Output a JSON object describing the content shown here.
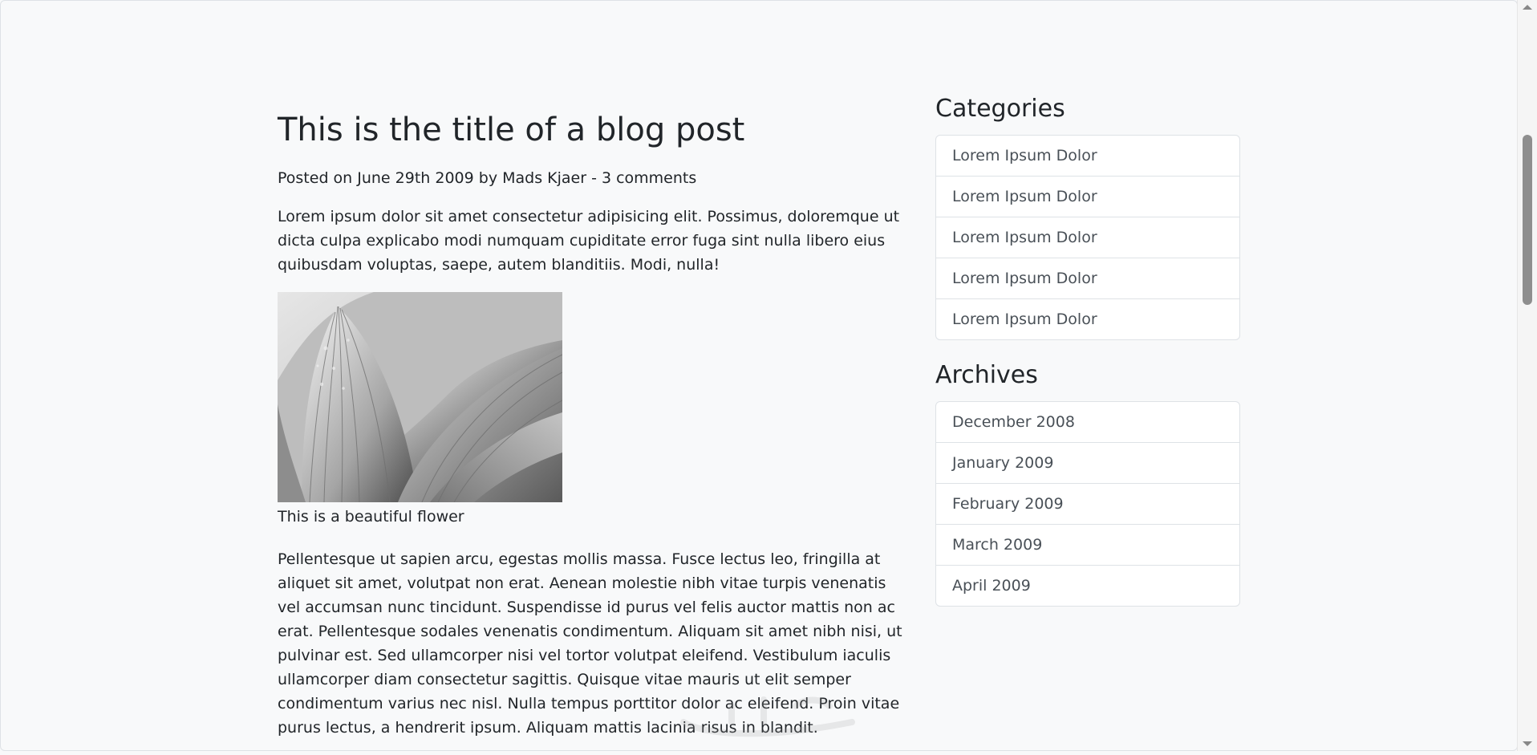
{
  "post": {
    "title": "This is the title of a blog post",
    "meta": "Posted on June 29th 2009 by Mads Kjaer - 3 comments",
    "intro": "Lorem ipsum dolor sit amet consectetur adipisicing elit. Possimus, doloremque ut dicta culpa explicabo modi numquam cupiditate error fuga sint nulla libero eius quibusdam voluptas, saepe, autem blanditiis. Modi, nulla!",
    "caption": "This is a beautiful flower",
    "body": "Pellentesque ut sapien arcu, egestas mollis massa. Fusce lectus leo, fringilla at aliquet sit amet, volutpat non erat. Aenean molestie nibh vitae turpis venenatis vel accumsan nunc tincidunt. Suspendisse id purus vel felis auctor mattis non ac erat. Pellentesque sodales venenatis condimentum. Aliquam sit amet nibh nisi, ut pulvinar est. Sed ullamcorper nisi vel tortor volutpat eleifend. Vestibulum iaculis ullamcorper diam consectetur sagittis. Quisque vitae mauris ut elit semper condimentum varius nec nisl. Nulla tempus porttitor dolor ac eleifend. Proin vitae purus lectus, a hendrerit ipsum. Aliquam mattis lacinia risus in blandit."
  },
  "sidebar": {
    "categories_heading": "Categories",
    "categories": [
      "Lorem Ipsum Dolor",
      "Lorem Ipsum Dolor",
      "Lorem Ipsum Dolor",
      "Lorem Ipsum Dolor",
      "Lorem Ipsum Dolor"
    ],
    "archives_heading": "Archives",
    "archives": [
      "December 2008",
      "January 2009",
      "February 2009",
      "March 2009",
      "April 2009"
    ]
  },
  "colors": {
    "background": "#f8f9fa",
    "text": "#212529",
    "muted": "#495057",
    "border": "#dee2e6"
  }
}
